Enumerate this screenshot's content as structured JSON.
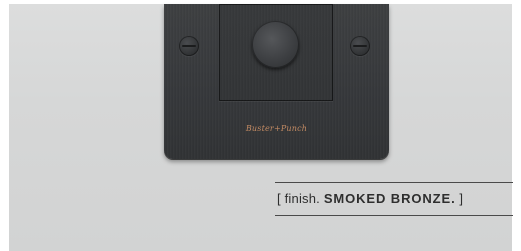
{
  "photo": {
    "subject": "dimmer-switch-plate",
    "colors": {
      "wall": "#d6d7d7",
      "plate": "#37393b",
      "brand_text": "#c28a63",
      "caption_text": "#2e2e2e"
    },
    "brand_mark": "Buster+Punch"
  },
  "caption": {
    "open_bracket": "[",
    "prefix": "finish.",
    "emphasis": "SMOKED BRONZE.",
    "close_bracket": "]"
  }
}
